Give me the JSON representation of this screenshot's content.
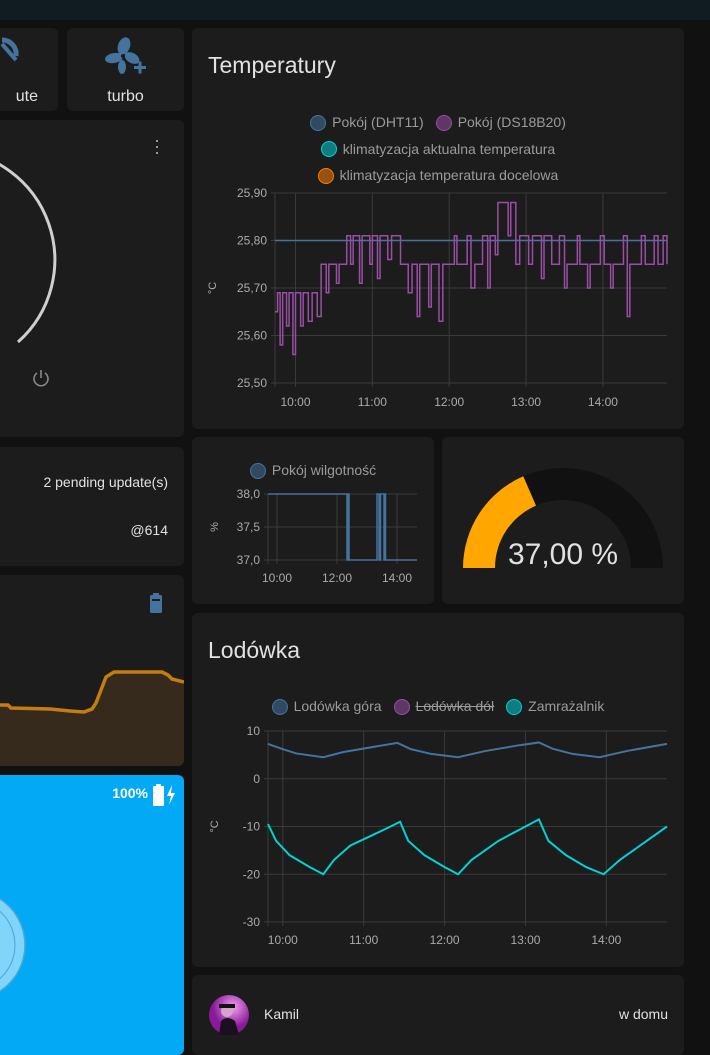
{
  "buttons": {
    "mute": "ute",
    "turbo": "turbo"
  },
  "updates": {
    "pending": "2 pending update(s)",
    "version": "@614"
  },
  "vacuum": {
    "battery": "100%"
  },
  "temperature": {
    "title": "Temperatury"
  },
  "fridge": {
    "title": "Lodówka"
  },
  "gauge": {
    "value": 37.0,
    "label": "37,00 %",
    "min": 0,
    "max": 100,
    "color": "#ffa600"
  },
  "person": {
    "name": "Kamil",
    "state": "w domu"
  },
  "chart_data": [
    {
      "type": "line",
      "id": "temp",
      "title": "Temperatury",
      "ylabel": "°C",
      "ylim": [
        25.5,
        25.9
      ],
      "yticks": [
        "25,50",
        "25,60",
        "25,70",
        "25,80",
        "25,90"
      ],
      "ytick_values": [
        25.5,
        25.6,
        25.7,
        25.8,
        25.9
      ],
      "xlim": [
        "09:44",
        "14:50"
      ],
      "xticks": [
        "10:00",
        "11:00",
        "12:00",
        "13:00",
        "14:00"
      ],
      "legend": [
        {
          "name": "Pokój (DHT11)",
          "color": "#44739e",
          "hidden": false
        },
        {
          "name": "Pokój (DS18B20)",
          "color": "#984ea3",
          "hidden": false
        },
        {
          "name": "klimatyzacja aktualna temperatura",
          "color": "#00d2d5",
          "hidden": false
        },
        {
          "name": "klimatyzacja temperatura docelowa",
          "color": "#ff7f00",
          "hidden": false
        }
      ],
      "series": [
        {
          "name": "Pokój (DHT11)",
          "color": "#44739e",
          "step": true,
          "points": [
            [
              "09:44",
              25.8
            ],
            [
              "14:50",
              25.8
            ]
          ]
        },
        {
          "name": "Pokój (DS18B20)",
          "color": "#984ea3",
          "step": true,
          "points": [
            [
              "09:44",
              25.65
            ],
            [
              "09:46",
              25.69
            ],
            [
              "09:48",
              25.58
            ],
            [
              "09:50",
              25.69
            ],
            [
              "09:53",
              25.62
            ],
            [
              "09:55",
              25.69
            ],
            [
              "09:58",
              25.56
            ],
            [
              "10:00",
              25.69
            ],
            [
              "10:04",
              25.62
            ],
            [
              "10:06",
              25.69
            ],
            [
              "10:10",
              25.63
            ],
            [
              "10:13",
              25.69
            ],
            [
              "10:17",
              25.64
            ],
            [
              "10:20",
              25.75
            ],
            [
              "10:24",
              25.69
            ],
            [
              "10:26",
              25.75
            ],
            [
              "10:32",
              25.71
            ],
            [
              "10:34",
              25.75
            ],
            [
              "10:40",
              25.81
            ],
            [
              "10:43",
              25.75
            ],
            [
              "10:45",
              25.81
            ],
            [
              "10:50",
              25.71
            ],
            [
              "10:52",
              25.81
            ],
            [
              "10:58",
              25.75
            ],
            [
              "11:00",
              25.81
            ],
            [
              "11:04",
              25.72
            ],
            [
              "11:06",
              25.81
            ],
            [
              "11:12",
              25.76
            ],
            [
              "11:15",
              25.81
            ],
            [
              "11:22",
              25.75
            ],
            [
              "11:28",
              25.69
            ],
            [
              "11:31",
              25.75
            ],
            [
              "11:35",
              25.64
            ],
            [
              "11:37",
              25.75
            ],
            [
              "11:44",
              25.66
            ],
            [
              "11:46",
              25.75
            ],
            [
              "11:52",
              25.63
            ],
            [
              "11:55",
              25.75
            ],
            [
              "12:04",
              25.81
            ],
            [
              "12:06",
              25.75
            ],
            [
              "12:14",
              25.81
            ],
            [
              "12:17",
              25.7
            ],
            [
              "12:20",
              25.75
            ],
            [
              "12:26",
              25.81
            ],
            [
              "12:30",
              25.7
            ],
            [
              "12:32",
              25.81
            ],
            [
              "12:36",
              25.77
            ],
            [
              "12:38",
              25.88
            ],
            [
              "12:46",
              25.81
            ],
            [
              "12:48",
              25.88
            ],
            [
              "12:52",
              25.75
            ],
            [
              "12:55",
              25.81
            ],
            [
              "13:02",
              25.75
            ],
            [
              "13:05",
              25.81
            ],
            [
              "13:12",
              25.72
            ],
            [
              "13:14",
              25.81
            ],
            [
              "13:20",
              25.75
            ],
            [
              "13:26",
              25.81
            ],
            [
              "13:30",
              25.7
            ],
            [
              "13:32",
              25.75
            ],
            [
              "13:40",
              25.81
            ],
            [
              "13:42",
              25.75
            ],
            [
              "13:48",
              25.7
            ],
            [
              "13:50",
              25.75
            ],
            [
              "13:58",
              25.81
            ],
            [
              "14:01",
              25.75
            ],
            [
              "14:06",
              25.7
            ],
            [
              "14:08",
              25.75
            ],
            [
              "14:16",
              25.81
            ],
            [
              "14:19",
              25.64
            ],
            [
              "14:21",
              25.75
            ],
            [
              "14:30",
              25.81
            ],
            [
              "14:33",
              25.75
            ],
            [
              "14:40",
              25.81
            ],
            [
              "14:43",
              25.75
            ],
            [
              "14:47",
              25.81
            ],
            [
              "14:50",
              25.75
            ]
          ]
        }
      ]
    },
    {
      "type": "line",
      "id": "hum",
      "ylabel": "%",
      "ylim": [
        37.0,
        38.0
      ],
      "yticks": [
        "37,0",
        "37,5",
        "38,0"
      ],
      "ytick_values": [
        37.0,
        37.5,
        38.0
      ],
      "xlim": [
        "09:42",
        "14:40"
      ],
      "xticks": [
        "10:00",
        "12:00",
        "14:00"
      ],
      "legend": [
        {
          "name": "Pokój wilgotność",
          "color": "#44739e",
          "hidden": false
        }
      ],
      "series": [
        {
          "name": "Pokój wilgotność",
          "color": "#44739e",
          "step": true,
          "points": [
            [
              "09:42",
              38
            ],
            [
              "12:20",
              37
            ],
            [
              "12:22",
              38
            ],
            [
              "12:24",
              37
            ],
            [
              "13:20",
              38
            ],
            [
              "13:24",
              37
            ],
            [
              "13:27",
              38
            ],
            [
              "13:34",
              37
            ],
            [
              "13:36",
              38
            ],
            [
              "13:37",
              37
            ],
            [
              "14:40",
              37
            ]
          ]
        }
      ]
    },
    {
      "type": "line",
      "id": "fridge",
      "title": "Lodówka",
      "ylabel": "°C",
      "ylim": [
        -30,
        10
      ],
      "yticks": [
        "-30",
        "-20",
        "-10",
        "0",
        "10"
      ],
      "ytick_values": [
        -30,
        -20,
        -10,
        0,
        10
      ],
      "xlim": [
        "09:49",
        "14:45"
      ],
      "xticks": [
        "10:00",
        "11:00",
        "12:00",
        "13:00",
        "14:00"
      ],
      "legend": [
        {
          "name": "Lodówka góra",
          "color": "#44739e",
          "hidden": false
        },
        {
          "name": "Lodówka dół",
          "color": "#984ea3",
          "hidden": true
        },
        {
          "name": "Zamrażalnik",
          "color": "#00d2d5",
          "hidden": false
        }
      ],
      "series": [
        {
          "name": "Lodówka góra",
          "color": "#44739e",
          "step": false,
          "points": [
            [
              "09:49",
              7.3
            ],
            [
              "10:00",
              6.2
            ],
            [
              "10:10",
              5.3
            ],
            [
              "10:30",
              4.5
            ],
            [
              "10:45",
              5.6
            ],
            [
              "11:10",
              6.8
            ],
            [
              "11:25",
              7.5
            ],
            [
              "11:35",
              6.2
            ],
            [
              "11:50",
              5.2
            ],
            [
              "12:10",
              4.5
            ],
            [
              "12:30",
              5.8
            ],
            [
              "12:55",
              7.0
            ],
            [
              "13:10",
              7.6
            ],
            [
              "13:20",
              6.3
            ],
            [
              "13:35",
              5.2
            ],
            [
              "13:55",
              4.5
            ],
            [
              "14:15",
              5.8
            ],
            [
              "14:45",
              7.3
            ]
          ]
        },
        {
          "name": "Zamrażalnik",
          "color": "#00d2d5",
          "step": false,
          "points": [
            [
              "09:49",
              -9.5
            ],
            [
              "09:55",
              -13
            ],
            [
              "10:05",
              -16
            ],
            [
              "10:20",
              -18.5
            ],
            [
              "10:30",
              -20
            ],
            [
              "10:38",
              -17
            ],
            [
              "10:50",
              -14
            ],
            [
              "11:05",
              -12
            ],
            [
              "11:20",
              -10
            ],
            [
              "11:27",
              -9
            ],
            [
              "11:33",
              -13
            ],
            [
              "11:45",
              -16
            ],
            [
              "12:00",
              -18.5
            ],
            [
              "12:10",
              -20
            ],
            [
              "12:20",
              -17
            ],
            [
              "12:40",
              -13
            ],
            [
              "13:00",
              -10
            ],
            [
              "13:10",
              -8.5
            ],
            [
              "13:17",
              -13
            ],
            [
              "13:30",
              -16
            ],
            [
              "13:45",
              -18.5
            ],
            [
              "13:58",
              -20
            ],
            [
              "14:10",
              -17
            ],
            [
              "14:30",
              -13
            ],
            [
              "14:45",
              -10
            ]
          ]
        }
      ]
    }
  ]
}
